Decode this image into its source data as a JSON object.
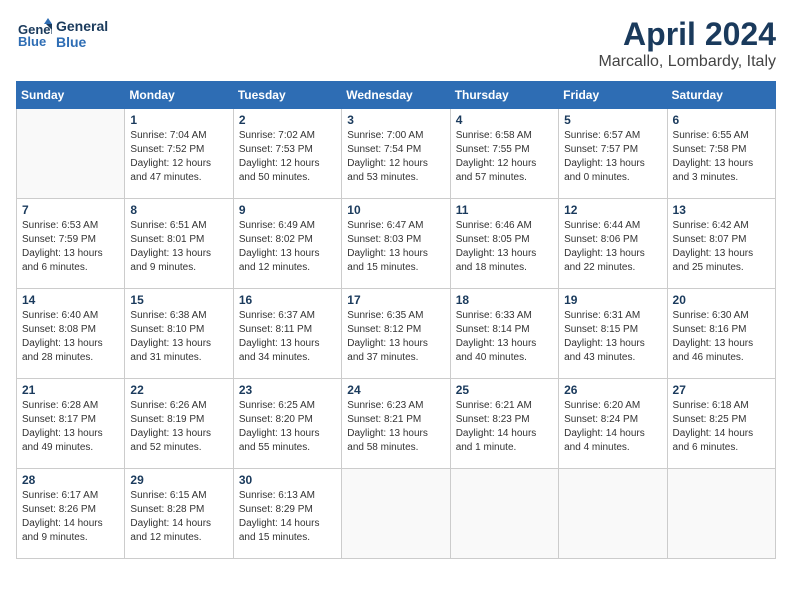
{
  "header": {
    "logo_line1": "General",
    "logo_line2": "Blue",
    "month": "April 2024",
    "location": "Marcallo, Lombardy, Italy"
  },
  "weekdays": [
    "Sunday",
    "Monday",
    "Tuesday",
    "Wednesday",
    "Thursday",
    "Friday",
    "Saturday"
  ],
  "weeks": [
    [
      {
        "day": "",
        "info": ""
      },
      {
        "day": "1",
        "info": "Sunrise: 7:04 AM\nSunset: 7:52 PM\nDaylight: 12 hours\nand 47 minutes."
      },
      {
        "day": "2",
        "info": "Sunrise: 7:02 AM\nSunset: 7:53 PM\nDaylight: 12 hours\nand 50 minutes."
      },
      {
        "day": "3",
        "info": "Sunrise: 7:00 AM\nSunset: 7:54 PM\nDaylight: 12 hours\nand 53 minutes."
      },
      {
        "day": "4",
        "info": "Sunrise: 6:58 AM\nSunset: 7:55 PM\nDaylight: 12 hours\nand 57 minutes."
      },
      {
        "day": "5",
        "info": "Sunrise: 6:57 AM\nSunset: 7:57 PM\nDaylight: 13 hours\nand 0 minutes."
      },
      {
        "day": "6",
        "info": "Sunrise: 6:55 AM\nSunset: 7:58 PM\nDaylight: 13 hours\nand 3 minutes."
      }
    ],
    [
      {
        "day": "7",
        "info": "Sunrise: 6:53 AM\nSunset: 7:59 PM\nDaylight: 13 hours\nand 6 minutes."
      },
      {
        "day": "8",
        "info": "Sunrise: 6:51 AM\nSunset: 8:01 PM\nDaylight: 13 hours\nand 9 minutes."
      },
      {
        "day": "9",
        "info": "Sunrise: 6:49 AM\nSunset: 8:02 PM\nDaylight: 13 hours\nand 12 minutes."
      },
      {
        "day": "10",
        "info": "Sunrise: 6:47 AM\nSunset: 8:03 PM\nDaylight: 13 hours\nand 15 minutes."
      },
      {
        "day": "11",
        "info": "Sunrise: 6:46 AM\nSunset: 8:05 PM\nDaylight: 13 hours\nand 18 minutes."
      },
      {
        "day": "12",
        "info": "Sunrise: 6:44 AM\nSunset: 8:06 PM\nDaylight: 13 hours\nand 22 minutes."
      },
      {
        "day": "13",
        "info": "Sunrise: 6:42 AM\nSunset: 8:07 PM\nDaylight: 13 hours\nand 25 minutes."
      }
    ],
    [
      {
        "day": "14",
        "info": "Sunrise: 6:40 AM\nSunset: 8:08 PM\nDaylight: 13 hours\nand 28 minutes."
      },
      {
        "day": "15",
        "info": "Sunrise: 6:38 AM\nSunset: 8:10 PM\nDaylight: 13 hours\nand 31 minutes."
      },
      {
        "day": "16",
        "info": "Sunrise: 6:37 AM\nSunset: 8:11 PM\nDaylight: 13 hours\nand 34 minutes."
      },
      {
        "day": "17",
        "info": "Sunrise: 6:35 AM\nSunset: 8:12 PM\nDaylight: 13 hours\nand 37 minutes."
      },
      {
        "day": "18",
        "info": "Sunrise: 6:33 AM\nSunset: 8:14 PM\nDaylight: 13 hours\nand 40 minutes."
      },
      {
        "day": "19",
        "info": "Sunrise: 6:31 AM\nSunset: 8:15 PM\nDaylight: 13 hours\nand 43 minutes."
      },
      {
        "day": "20",
        "info": "Sunrise: 6:30 AM\nSunset: 8:16 PM\nDaylight: 13 hours\nand 46 minutes."
      }
    ],
    [
      {
        "day": "21",
        "info": "Sunrise: 6:28 AM\nSunset: 8:17 PM\nDaylight: 13 hours\nand 49 minutes."
      },
      {
        "day": "22",
        "info": "Sunrise: 6:26 AM\nSunset: 8:19 PM\nDaylight: 13 hours\nand 52 minutes."
      },
      {
        "day": "23",
        "info": "Sunrise: 6:25 AM\nSunset: 8:20 PM\nDaylight: 13 hours\nand 55 minutes."
      },
      {
        "day": "24",
        "info": "Sunrise: 6:23 AM\nSunset: 8:21 PM\nDaylight: 13 hours\nand 58 minutes."
      },
      {
        "day": "25",
        "info": "Sunrise: 6:21 AM\nSunset: 8:23 PM\nDaylight: 14 hours\nand 1 minute."
      },
      {
        "day": "26",
        "info": "Sunrise: 6:20 AM\nSunset: 8:24 PM\nDaylight: 14 hours\nand 4 minutes."
      },
      {
        "day": "27",
        "info": "Sunrise: 6:18 AM\nSunset: 8:25 PM\nDaylight: 14 hours\nand 6 minutes."
      }
    ],
    [
      {
        "day": "28",
        "info": "Sunrise: 6:17 AM\nSunset: 8:26 PM\nDaylight: 14 hours\nand 9 minutes."
      },
      {
        "day": "29",
        "info": "Sunrise: 6:15 AM\nSunset: 8:28 PM\nDaylight: 14 hours\nand 12 minutes."
      },
      {
        "day": "30",
        "info": "Sunrise: 6:13 AM\nSunset: 8:29 PM\nDaylight: 14 hours\nand 15 minutes."
      },
      {
        "day": "",
        "info": ""
      },
      {
        "day": "",
        "info": ""
      },
      {
        "day": "",
        "info": ""
      },
      {
        "day": "",
        "info": ""
      }
    ]
  ]
}
